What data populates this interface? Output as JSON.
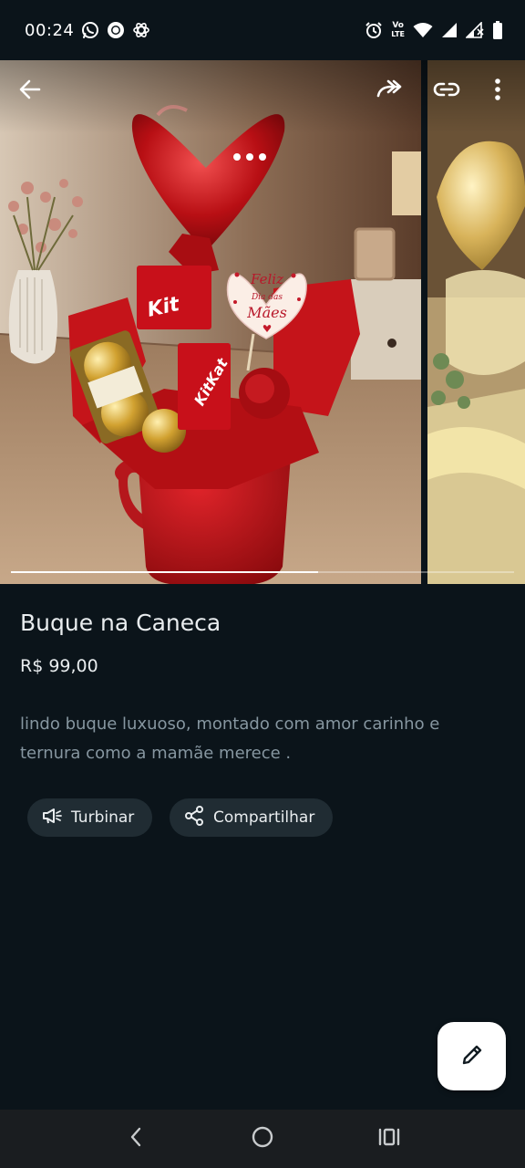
{
  "status_bar": {
    "time": "00:24",
    "left_icons": [
      "whatsapp-icon",
      "record-icon",
      "chatgpt-icon"
    ],
    "right_icons": [
      "alarm-icon",
      "volte-icon",
      "wifi-icon",
      "signal-icon",
      "signal-weak-icon",
      "battery-icon"
    ],
    "volte_top": "Vo",
    "volte_bottom": "LTE"
  },
  "media": {
    "top_actions": [
      "back-icon",
      "forward-icon",
      "link-icon",
      "more-icon"
    ],
    "balloon_tag_line1": "Feliz",
    "balloon_tag_line2": "Dia das",
    "balloon_tag_line3": "Mães",
    "wrapper_brand": "KitKat",
    "progress": 0.61
  },
  "product": {
    "title": "Buque na Caneca",
    "price": "R$ 99,00",
    "description": "lindo buque luxuoso, montado com amor carinho e ternura como a mamãe merece ."
  },
  "actions": {
    "boost_label": "Turbinar",
    "share_label": "Compartilhar"
  },
  "colors": {
    "background": "#0b141a",
    "chip": "#202c33",
    "text_primary": "#e9edef",
    "text_secondary": "#8696a0",
    "fab": "#ffffff"
  }
}
